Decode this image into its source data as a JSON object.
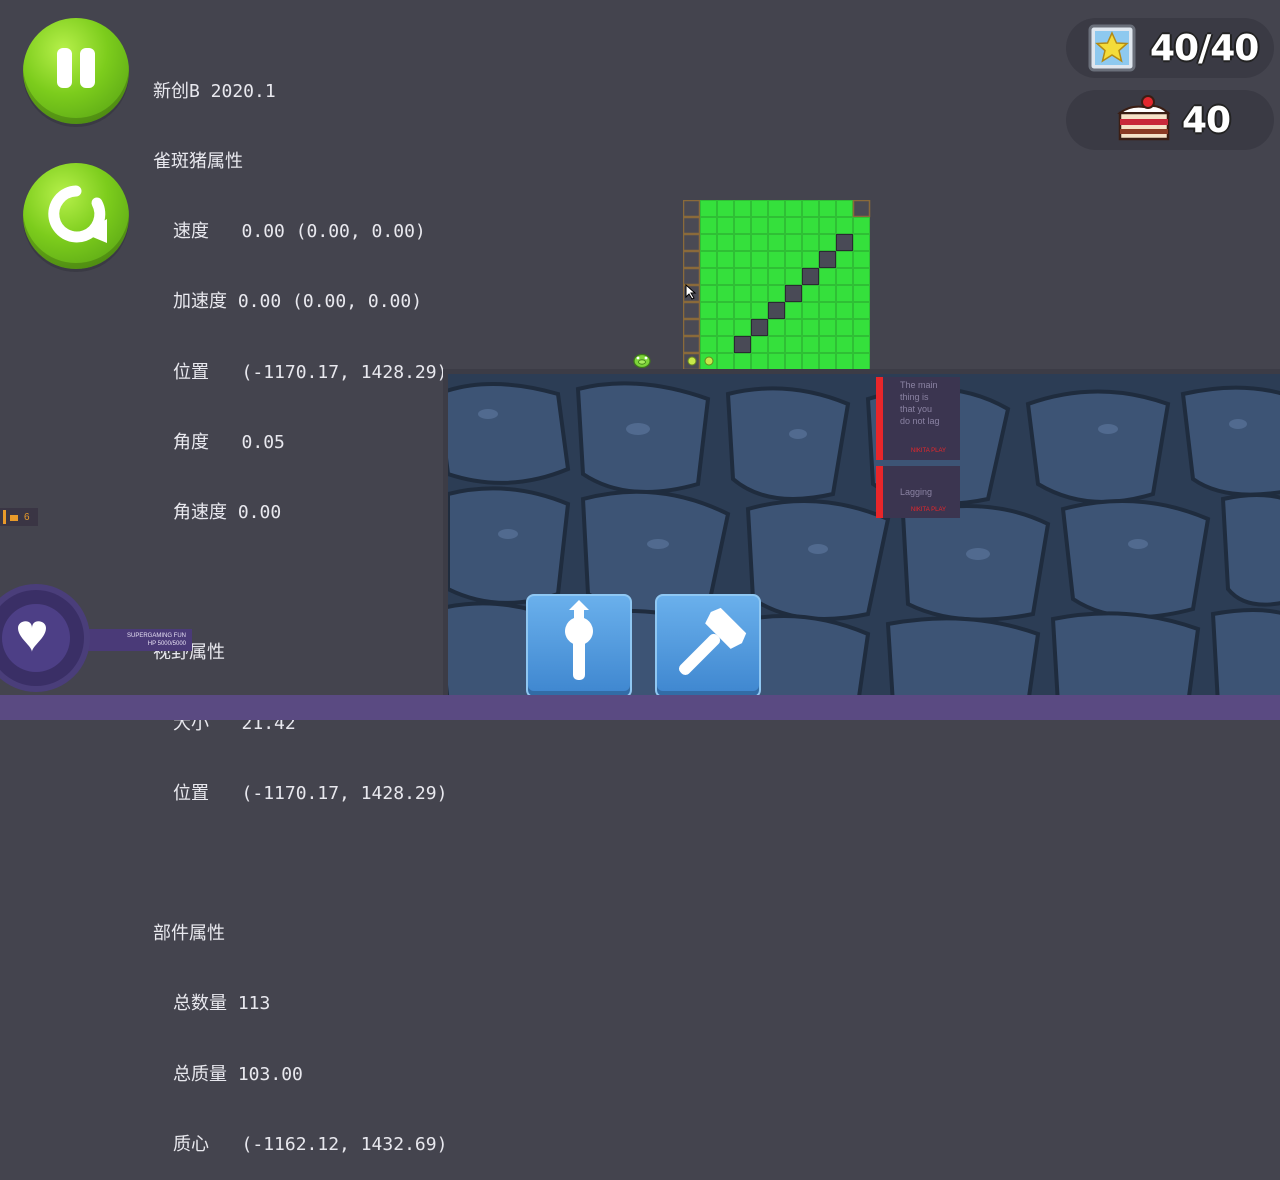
{
  "controls": {
    "pause_icon": "pause-icon",
    "restart_icon": "restart-icon"
  },
  "debug": {
    "build": "新创B 2020.1",
    "pig_title": "雀斑猪属性",
    "speed_label": "速度",
    "speed_value": "0.00 (0.00, 0.00)",
    "accel_label": "加速度",
    "accel_value": "0.00 (0.00, 0.00)",
    "pos_label": "位置",
    "pos_value": "(-1170.17, 1428.29)",
    "angle_label": "角度",
    "angle_value": "0.05",
    "angvel_label": "角速度",
    "angvel_value": "0.00",
    "view_title": "视野属性",
    "size_label": "大小",
    "size_value": "21.42",
    "view_pos_label": "位置",
    "view_pos_value": "(-1170.17, 1428.29)",
    "parts_title": "部件属性",
    "count_label": "总数量",
    "count_value": "113",
    "mass_label": "总质量",
    "mass_value": "103.00",
    "com_label": "质心",
    "com_value": "(-1162.12, 1432.69)"
  },
  "hud": {
    "stars": "40/40",
    "cakes": "40",
    "star_icon": "star-icon",
    "cake_icon": "cake-icon"
  },
  "stream": {
    "left_counter": "6",
    "supporter_name": "SUPERGAMING FUN",
    "supporter_hp": "HP 5000/5000",
    "note1_text": "The main thing is that you do not lag",
    "note1_author": "NIKITA PLAY",
    "note2_text": "Lagging",
    "note2_author": "NIKITA PLAY"
  },
  "tools": [
    "wrench-icon",
    "hammer-icon"
  ],
  "colors": {
    "grid_green": "#35e03c",
    "grid_dark": "#494a56",
    "frame_brown": "#8a6a3a",
    "ground": "#2c3d55",
    "button_green": "#7ccc1c",
    "note_red": "#e8262a"
  }
}
